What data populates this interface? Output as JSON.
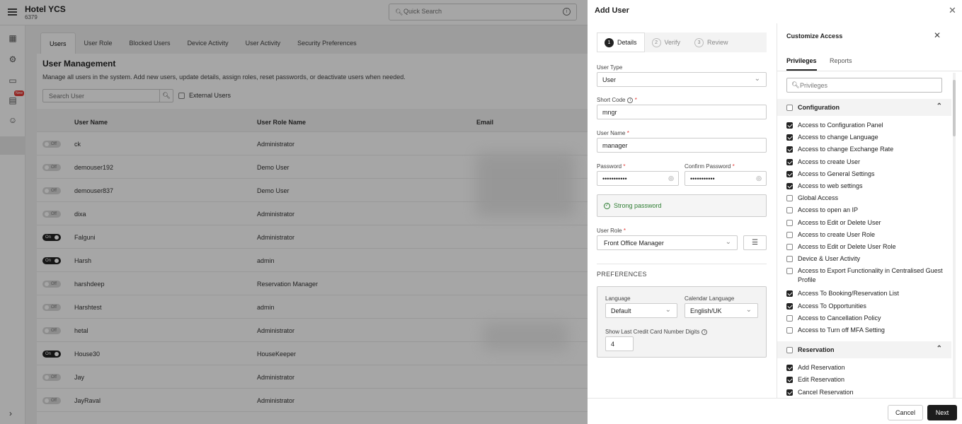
{
  "app": {
    "hotel_name": "Hotel YCS",
    "hotel_code": "6379",
    "quick_search_placeholder": "Quick Search",
    "new_badge": "New"
  },
  "tabs": [
    "Users",
    "User Role",
    "Blocked Users",
    "Device Activity",
    "User Activity",
    "Security Preferences"
  ],
  "user_mgmt": {
    "title": "User Management",
    "description": "Manage all users in the system. Add new users, update details, assign roles, reset passwords, or deactivate users when needed.",
    "search_placeholder": "Search User",
    "external_users_label": "External Users",
    "columns": [
      "User Name",
      "User Role Name",
      "Email"
    ],
    "rows": [
      {
        "status": "Off",
        "name": "ck",
        "role": "Administrator"
      },
      {
        "status": "Off",
        "name": "demouser192",
        "role": "Demo User"
      },
      {
        "status": "Off",
        "name": "demouser837",
        "role": "Demo User"
      },
      {
        "status": "Off",
        "name": "dixa",
        "role": "Administrator"
      },
      {
        "status": "On",
        "name": "Falguni",
        "role": "Administrator"
      },
      {
        "status": "On",
        "name": "Harsh",
        "role": "admin"
      },
      {
        "status": "Off",
        "name": "harshdeep",
        "role": "Reservation Manager"
      },
      {
        "status": "Off",
        "name": "Harshtest",
        "role": "admin"
      },
      {
        "status": "Off",
        "name": "hetal",
        "role": "Administrator"
      },
      {
        "status": "On",
        "name": "House30",
        "role": "HouseKeeper"
      },
      {
        "status": "Off",
        "name": "Jay",
        "role": "Administrator"
      },
      {
        "status": "Off",
        "name": "JayRaval",
        "role": "Administrator"
      }
    ]
  },
  "drawer": {
    "title": "Add User",
    "steps": [
      {
        "num": "1",
        "label": "Details"
      },
      {
        "num": "2",
        "label": "Verify"
      },
      {
        "num": "3",
        "label": "Review"
      }
    ],
    "user_type_label": "User Type",
    "user_type_value": "User",
    "short_code_label": "Short Code",
    "short_code_value": "mngr",
    "user_name_label": "User Name",
    "user_name_value": "manager",
    "password_label": "Password",
    "password_value": "•••••••••••",
    "confirm_password_label": "Confirm Password",
    "confirm_password_value": "•••••••••••",
    "strong_password_text": "Strong password",
    "user_role_label": "User Role",
    "user_role_value": "Front Office Manager",
    "required_mark": "*",
    "preferences": {
      "title": "PREFERENCES",
      "language_label": "Language",
      "language_value": "Default",
      "calendar_language_label": "Calendar Language",
      "calendar_language_value": "English/UK",
      "cc_digits_label": "Show Last Credit Card Number Digits",
      "cc_digits_value": "4"
    },
    "cancel_label": "Cancel",
    "next_label": "Next"
  },
  "customize_access": {
    "title": "Customize Access",
    "tabs": [
      "Privileges",
      "Reports"
    ],
    "search_placeholder": "Privileges",
    "sections": [
      {
        "name": "Configuration",
        "items": [
          {
            "label": "Access to Configuration Panel",
            "checked": true
          },
          {
            "label": "Access to change Language",
            "checked": true
          },
          {
            "label": "Access to change Exchange Rate",
            "checked": true
          },
          {
            "label": "Access to create User",
            "checked": true
          },
          {
            "label": "Access to General Settings",
            "checked": true
          },
          {
            "label": "Access to web settings",
            "checked": true
          },
          {
            "label": "Global Access",
            "checked": false
          },
          {
            "label": "Access to open an IP",
            "checked": false
          },
          {
            "label": "Access to Edit or Delete User",
            "checked": false
          },
          {
            "label": "Access to create User Role",
            "checked": false
          },
          {
            "label": "Access to Edit or Delete User Role",
            "checked": false
          },
          {
            "label": "Device & User Activity",
            "checked": false
          },
          {
            "label": "Access to Export Functionality in Centralised Guest Profile",
            "checked": false
          },
          {
            "label": "Access To Booking/Reservation List",
            "checked": true
          },
          {
            "label": "Access To Opportunities",
            "checked": true
          },
          {
            "label": "Access to Cancellation Policy",
            "checked": false
          },
          {
            "label": "Access to Turn off MFA Setting",
            "checked": false
          }
        ]
      },
      {
        "name": "Reservation",
        "items": [
          {
            "label": "Add Reservation",
            "checked": true
          },
          {
            "label": "Edit Reservation",
            "checked": true
          },
          {
            "label": "Cancel Reservation",
            "checked": true
          }
        ]
      }
    ]
  }
}
